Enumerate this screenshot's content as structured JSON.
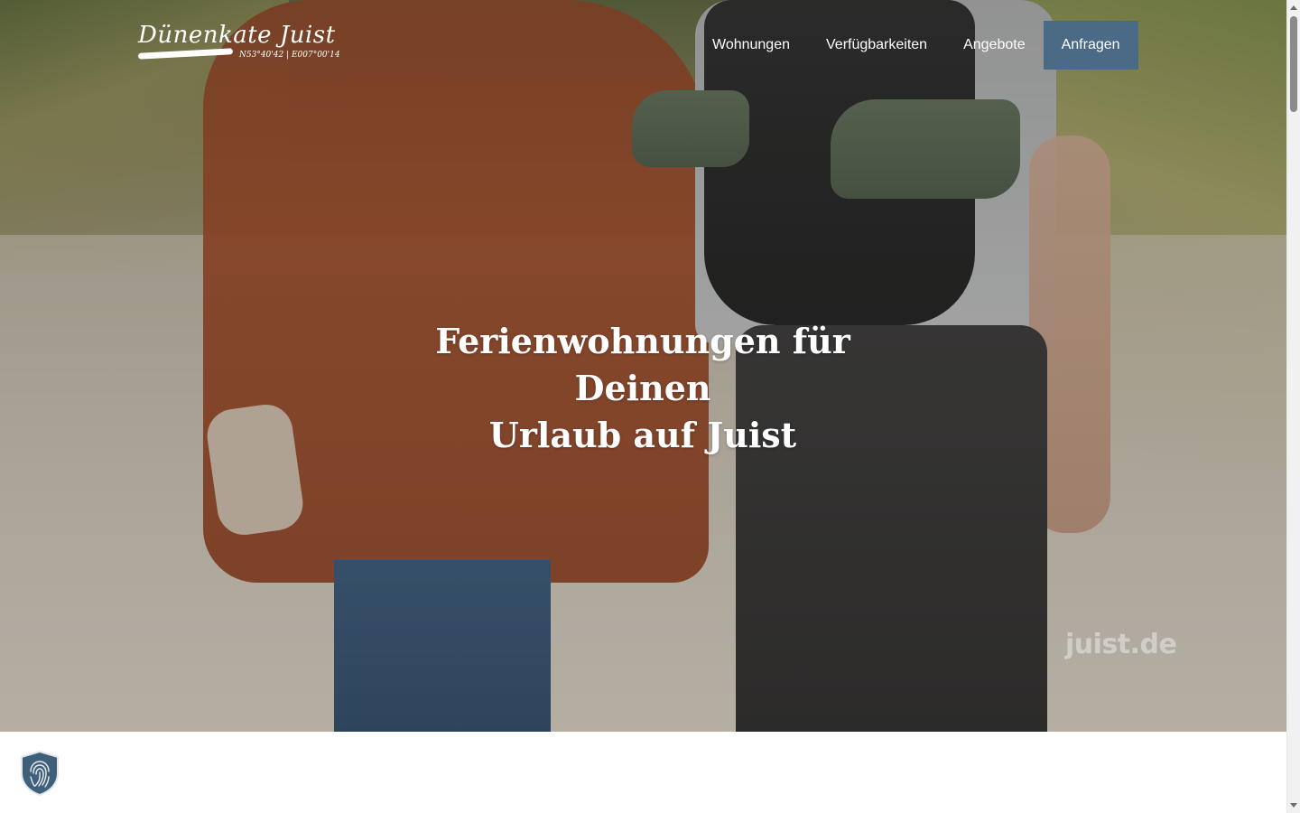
{
  "brand": {
    "name": "Dünenkate Juist",
    "coords": "N53°40'42 | E007°00'14"
  },
  "nav": {
    "items": [
      {
        "label": "Wohnungen"
      },
      {
        "label": "Verfügbarkeiten"
      },
      {
        "label": "Angebote"
      },
      {
        "label": "Anfragen"
      }
    ]
  },
  "hero": {
    "title_line1": "Ferienwohnungen für Deinen",
    "title_line2": "Urlaub auf Juist",
    "watermark": "juist.de"
  },
  "colors": {
    "cta": "#4b6a85",
    "badge": "#3f5f7a"
  },
  "icons": {
    "privacy": "fingerprint-shield-icon"
  }
}
